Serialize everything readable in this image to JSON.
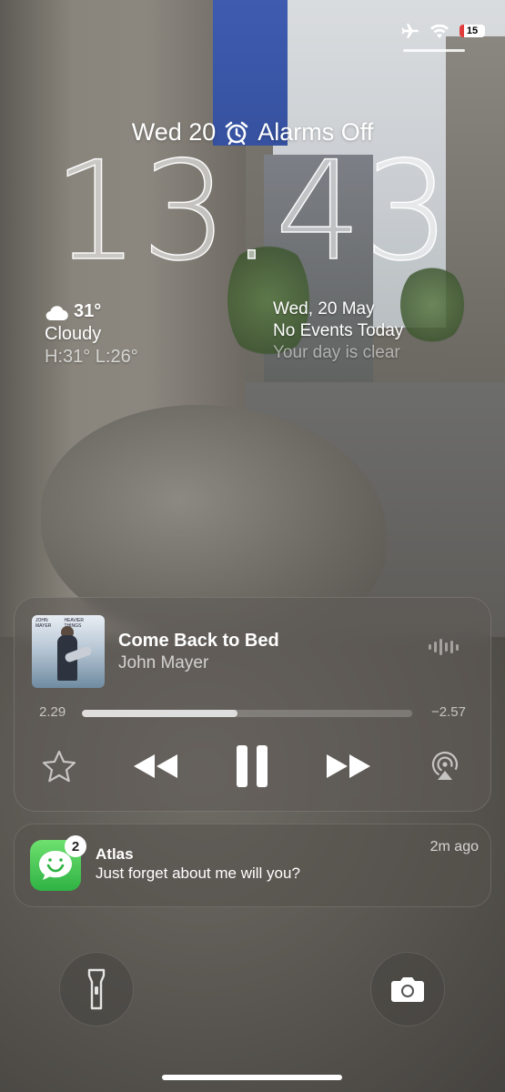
{
  "status_bar": {
    "battery": "15",
    "icons": [
      "airplane-icon",
      "wifi-icon",
      "battery-icon"
    ]
  },
  "lockscreen": {
    "date": "Wed 20",
    "alarm_status": "Alarms Off",
    "time": "13.43"
  },
  "weather_widget": {
    "temp": "31°",
    "condition": "Cloudy",
    "high_low": "H:31° L:26°"
  },
  "calendar_widget": {
    "date": "Wed, 20 May",
    "events": "No Events Today",
    "subtitle": "Your day is clear"
  },
  "now_playing": {
    "album_text_left": "JOHN MAYER",
    "album_text_right": "HEAVIER THINGS",
    "title": "Come Back to Bed",
    "artist": "John Mayer",
    "elapsed": "2.29",
    "remaining": "−2.57",
    "progress": 0.47
  },
  "notification": {
    "app": "Atlas",
    "message": "Just forget about me will you?",
    "time": "2m ago",
    "badge_count": "2"
  },
  "colors": {
    "accent_green": "#3cc452",
    "battery_low": "#e23b3b"
  }
}
